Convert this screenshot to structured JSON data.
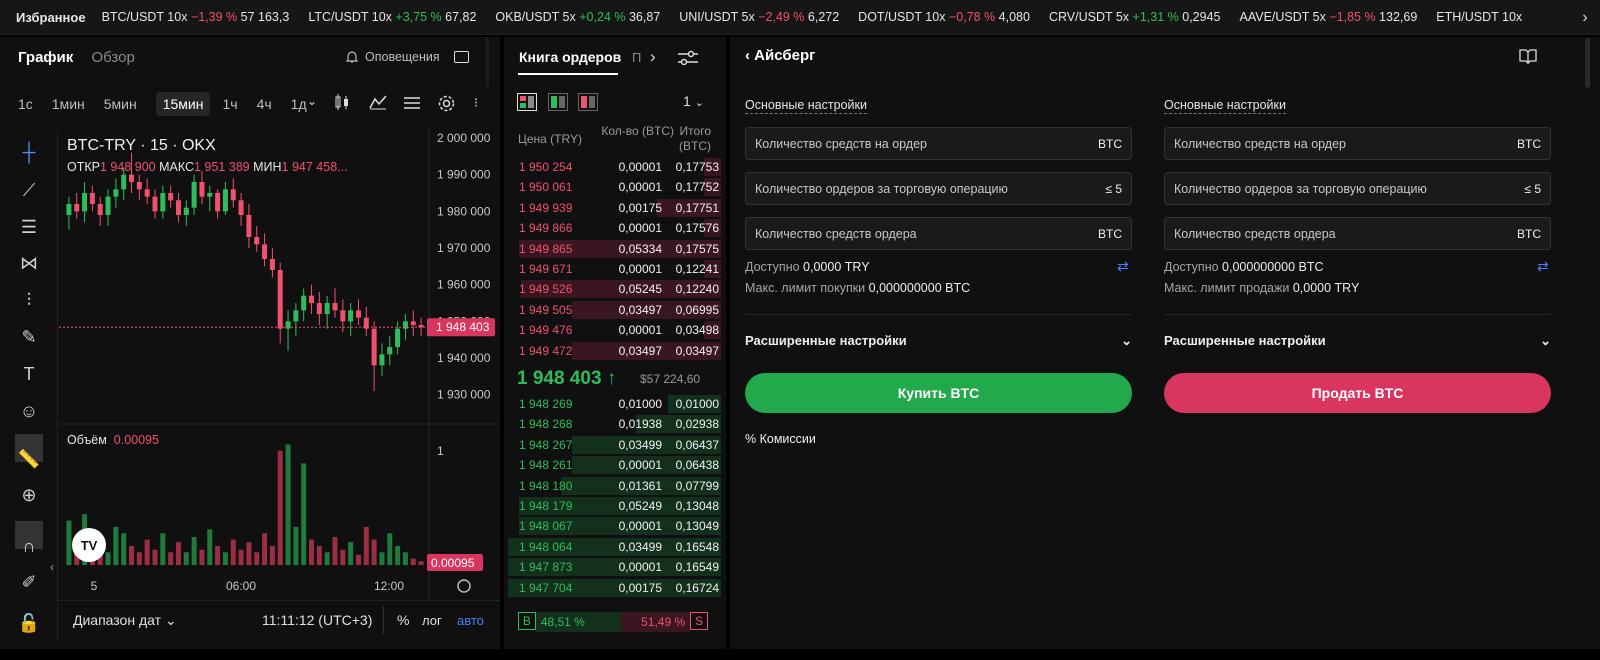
{
  "ticker": {
    "favorites": "Избранное",
    "items": [
      {
        "pair": "BTC/USDT 10x",
        "change": "−1,39 %",
        "dir": "dn",
        "price": "57 163,3"
      },
      {
        "pair": "LTC/USDT 10x",
        "change": "+3,75 %",
        "dir": "up",
        "price": "67,82"
      },
      {
        "pair": "OKB/USDT 5x",
        "change": "+0,24 %",
        "dir": "up",
        "price": "36,87"
      },
      {
        "pair": "UNI/USDT 5x",
        "change": "−2,49 %",
        "dir": "dn",
        "price": "6,272"
      },
      {
        "pair": "DOT/USDT 10x",
        "change": "−0,78 %",
        "dir": "dn",
        "price": "4,080"
      },
      {
        "pair": "CRV/USDT 5x",
        "change": "+1,31 %",
        "dir": "up",
        "price": "0,2945"
      },
      {
        "pair": "AAVE/USDT 5x",
        "change": "−1,85 %",
        "dir": "dn",
        "price": "132,69"
      },
      {
        "pair": "ETH/USDT 10x",
        "change": "",
        "dir": "up",
        "price": ""
      }
    ]
  },
  "chart": {
    "tab_chart": "График",
    "tab_overview": "Обзор",
    "alerts": "Оповещения",
    "timeframes": [
      "1с",
      "1мин",
      "5мин",
      "15мин",
      "1ч",
      "4ч",
      "1д"
    ],
    "selected_tf": "15мин",
    "symbol": "BTC-TRY · 15 · OKX",
    "open_label": "ОТКР",
    "open": "1 948 900",
    "high_label": "МАКС",
    "high": "1 951 389",
    "low_label": "МИН",
    "low": "1 947 458...",
    "price_axis": [
      "2 000 000",
      "1 990 000",
      "1 980 000",
      "1 970 000",
      "1 960 000",
      "1 950 000",
      "1 940 000",
      "1 930 000"
    ],
    "last_price_tag": "1 948 403",
    "volume_label": "Объём",
    "volume_value": "0.00095",
    "volume_axis_top": "1",
    "volume_tag": "0.00095",
    "time_axis": [
      "5",
      "06:00",
      "12:00"
    ],
    "date_range": "Диапазон дат",
    "clock": "11:11:12 (UTC+3)",
    "percent": "%",
    "log": "лог",
    "auto": "авто",
    "tv_logo": "TV"
  },
  "chart_data": {
    "type": "candlestick",
    "ylim": [
      1925000,
      2000000
    ],
    "last_price": 1948403,
    "candles": [
      [
        1979000,
        1984000,
        1975000,
        1982000
      ],
      [
        1982000,
        1985000,
        1978000,
        1980000
      ],
      [
        1980000,
        1988000,
        1977000,
        1985000
      ],
      [
        1985000,
        1987000,
        1980000,
        1982000
      ],
      [
        1982000,
        1984000,
        1976000,
        1979000
      ],
      [
        1979000,
        1986000,
        1976000,
        1984000
      ],
      [
        1984000,
        1989000,
        1981000,
        1986000
      ],
      [
        1986000,
        1992000,
        1983000,
        1990000
      ],
      [
        1990000,
        1996000,
        1985000,
        1988000
      ],
      [
        1988000,
        1990000,
        1983000,
        1986000
      ],
      [
        1986000,
        1989000,
        1982000,
        1984000
      ],
      [
        1984000,
        1986000,
        1978000,
        1980000
      ],
      [
        1980000,
        1987000,
        1978000,
        1985000
      ],
      [
        1985000,
        1987000,
        1981000,
        1983000
      ],
      [
        1983000,
        1985000,
        1977000,
        1979000
      ],
      [
        1979000,
        1983000,
        1976000,
        1981000
      ],
      [
        1981000,
        1990000,
        1979000,
        1988000
      ],
      [
        1988000,
        1991000,
        1982000,
        1984000
      ],
      [
        1984000,
        1987000,
        1980000,
        1985000
      ],
      [
        1985000,
        1986000,
        1978000,
        1980000
      ],
      [
        1980000,
        1988000,
        1979000,
        1986000
      ],
      [
        1986000,
        1989000,
        1981000,
        1983000
      ],
      [
        1983000,
        1985000,
        1976000,
        1979000
      ],
      [
        1979000,
        1982000,
        1970000,
        1973000
      ],
      [
        1973000,
        1976000,
        1969000,
        1971000
      ],
      [
        1971000,
        1974000,
        1965000,
        1967000
      ],
      [
        1967000,
        1970000,
        1962000,
        1964000
      ],
      [
        1964000,
        1966000,
        1944000,
        1948000
      ],
      [
        1948000,
        1953000,
        1942000,
        1950000
      ],
      [
        1950000,
        1955000,
        1946000,
        1953000
      ],
      [
        1953000,
        1959000,
        1950000,
        1957000
      ],
      [
        1957000,
        1960000,
        1952000,
        1955000
      ],
      [
        1955000,
        1958000,
        1949000,
        1952000
      ],
      [
        1952000,
        1957000,
        1948000,
        1955000
      ],
      [
        1955000,
        1959000,
        1951000,
        1953000
      ],
      [
        1953000,
        1956000,
        1947000,
        1950000
      ],
      [
        1950000,
        1955000,
        1946000,
        1953000
      ],
      [
        1953000,
        1956000,
        1949000,
        1951000
      ],
      [
        1951000,
        1954000,
        1946000,
        1948000
      ],
      [
        1948000,
        1950000,
        1931000,
        1938000
      ],
      [
        1938000,
        1944000,
        1935000,
        1941000
      ],
      [
        1941000,
        1946000,
        1938000,
        1943000
      ],
      [
        1943000,
        1950000,
        1941000,
        1948000
      ],
      [
        1948000,
        1952000,
        1945000,
        1950000
      ],
      [
        1950000,
        1953000,
        1946000,
        1949000
      ],
      [
        1949000,
        1951000,
        1946000,
        1948403
      ]
    ],
    "volumes": [
      0.35,
      0.2,
      0.4,
      0.12,
      0.2,
      0.1,
      0.3,
      0.25,
      0.15,
      0.1,
      0.2,
      0.12,
      0.25,
      0.1,
      0.18,
      0.1,
      0.22,
      0.12,
      0.28,
      0.15,
      0.1,
      0.2,
      0.12,
      0.18,
      0.1,
      0.25,
      0.15,
      0.9,
      0.95,
      0.3,
      0.8,
      0.2,
      0.15,
      0.1,
      0.22,
      0.12,
      0.18,
      0.08,
      0.3,
      0.2,
      0.1,
      0.25,
      0.15,
      0.1,
      0.05,
      0.03
    ]
  },
  "book": {
    "tab": "Книга ордеров",
    "tab2": "П",
    "depth": "1",
    "col_price": "Цена (TRY)",
    "col_qty": "Кол-во (BTC)",
    "col_total": "Итого (BTC)",
    "asks": [
      {
        "p": "1 950 254",
        "q": "0,00001",
        "t": "0,17753",
        "d": 0.08
      },
      {
        "p": "1 950 061",
        "q": "0,00001",
        "t": "0,17752",
        "d": 0.08
      },
      {
        "p": "1 949 939",
        "q": "0,00175",
        "t": "0,17751",
        "d": 0.3
      },
      {
        "p": "1 949 866",
        "q": "0,00001",
        "t": "0,17576",
        "d": 0.08
      },
      {
        "p": "1 949 865",
        "q": "0,05334",
        "t": "0,17575",
        "d": 0.95
      },
      {
        "p": "1 949 671",
        "q": "0,00001",
        "t": "0,12241",
        "d": 0.08
      },
      {
        "p": "1 949 526",
        "q": "0,05245",
        "t": "0,12240",
        "d": 0.94
      },
      {
        "p": "1 949 505",
        "q": "0,03497",
        "t": "0,06995",
        "d": 0.7
      },
      {
        "p": "1 949 476",
        "q": "0,00001",
        "t": "0,03498",
        "d": 0.08
      },
      {
        "p": "1 949 472",
        "q": "0,03497",
        "t": "0,03497",
        "d": 0.7
      }
    ],
    "mid_price": "1 948 403",
    "mid_usd": "$57 224,60",
    "bids": [
      {
        "p": "1 948 269",
        "q": "0,01000",
        "t": "0,01000",
        "d": 0.25
      },
      {
        "p": "1 948 268",
        "q": "0,01938",
        "t": "0,02938",
        "d": 0.4
      },
      {
        "p": "1 948 267",
        "q": "0,03499",
        "t": "0,06437",
        "d": 0.7
      },
      {
        "p": "1 948 261",
        "q": "0,00001",
        "t": "0,06438",
        "d": 0.7
      },
      {
        "p": "1 948 180",
        "q": "0,01361",
        "t": "0,07799",
        "d": 0.75
      },
      {
        "p": "1 948 179",
        "q": "0,05249",
        "t": "0,13048",
        "d": 0.95
      },
      {
        "p": "1 948 067",
        "q": "0,00001",
        "t": "0,13049",
        "d": 0.95
      },
      {
        "p": "1 948 064",
        "q": "0,03499",
        "t": "0,16548",
        "d": 1
      },
      {
        "p": "1 947 873",
        "q": "0,00001",
        "t": "0,16549",
        "d": 1
      },
      {
        "p": "1 947 704",
        "q": "0,00175",
        "t": "0,16724",
        "d": 1
      }
    ],
    "buy_badge": "B",
    "buy_pct": "48,51 %",
    "sell_pct": "51,49 %",
    "sell_badge": "S"
  },
  "order": {
    "back_title": "Айсберг",
    "buy": {
      "heading": "Основные настройки",
      "f1": "Количество средств на ордер",
      "f1u": "BTC",
      "f2": "Количество ордеров за торговую операцию",
      "f2u": "≤ 5",
      "f3": "Количество средств ордера",
      "f3u": "BTC",
      "avail_label": "Доступно",
      "avail": "0,0000 TRY",
      "limit_label": "Макс. лимит покупки",
      "limit": "0,000000000 BTC",
      "advanced": "Расширенные настройки",
      "button": "Купить BTC"
    },
    "sell": {
      "heading": "Основные настройки",
      "f1": "Количество средств на ордер",
      "f1u": "BTC",
      "f2": "Количество ордеров за торговую операцию",
      "f2u": "≤ 5",
      "f3": "Количество средств ордера",
      "f3u": "BTC",
      "avail_label": "Доступно",
      "avail": "0,000000000 BTC",
      "limit_label": "Макс. лимит продажи",
      "limit": "0,0000 TRY",
      "advanced": "Расширенные настройки",
      "button": "Продать BTC"
    },
    "fees": "Комиссии",
    "colors": {
      "buy": "#21a94b",
      "sell": "#d8365f"
    }
  }
}
